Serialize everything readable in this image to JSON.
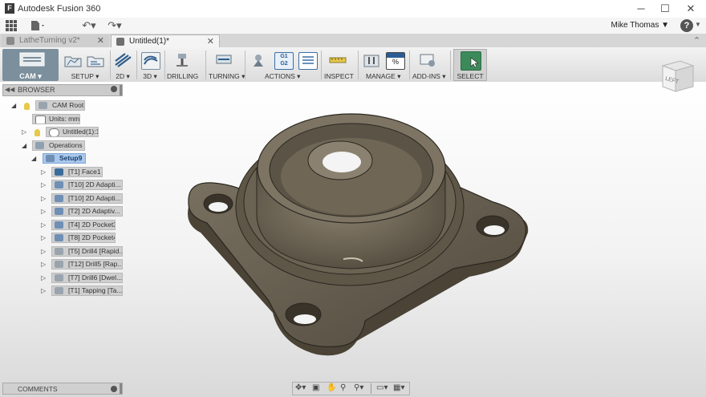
{
  "window": {
    "title": "Autodesk Fusion 360",
    "logo": "F",
    "controls": [
      "minimize-icon",
      "maximize-icon",
      "close-icon"
    ]
  },
  "quickbar": {
    "user_name": "Mike Thomas ▼",
    "help": "?"
  },
  "tabs": [
    {
      "label": "LatheTurning v2*",
      "active": false
    },
    {
      "label": "Untitled(1)*",
      "active": true
    }
  ],
  "ribbon": {
    "workspace": "CAM ▾",
    "groups": [
      {
        "label": "SETUP ▾"
      },
      {
        "label": "2D ▾"
      },
      {
        "label": "3D ▾"
      },
      {
        "label": "DRILLING"
      },
      {
        "label": "TURNING ▾"
      },
      {
        "label": "ACTIONS ▾"
      },
      {
        "label": "INSPECT"
      },
      {
        "label": "MANAGE ▾"
      },
      {
        "label": "ADD-INS ▾"
      },
      {
        "label": "SELECT"
      }
    ],
    "actions_icon_text": [
      "G1",
      "G2"
    ]
  },
  "browser": {
    "title": "BROWSER",
    "nodes": [
      {
        "label": "CAM Root"
      },
      {
        "label": "Units: mm"
      },
      {
        "label": "Untitled(1):1"
      },
      {
        "label": "Operations"
      },
      {
        "label": "Setup9"
      },
      {
        "label": "[T1] Face1"
      },
      {
        "label": "[T10] 2D Adapti..."
      },
      {
        "label": "[T10] 2D Adapti..."
      },
      {
        "label": "[T2] 2D Adaptiv..."
      },
      {
        "label": "[T4] 2D Pocket3"
      },
      {
        "label": "[T8] 2D Pocket4"
      },
      {
        "label": "[T5] Drill4 [Rapid..."
      },
      {
        "label": "[T12] Drill5 [Rap..."
      },
      {
        "label": "[T7] Drill6 [Dwel..."
      },
      {
        "label": "[T1] Tapping [Ta..."
      }
    ]
  },
  "comments": {
    "label": "COMMENTS"
  },
  "viewcube": {
    "face": "LEFT"
  },
  "colors": {
    "part": "#6f6656",
    "workspace": "#7c8f9c",
    "selection": "#a9c8ec"
  }
}
